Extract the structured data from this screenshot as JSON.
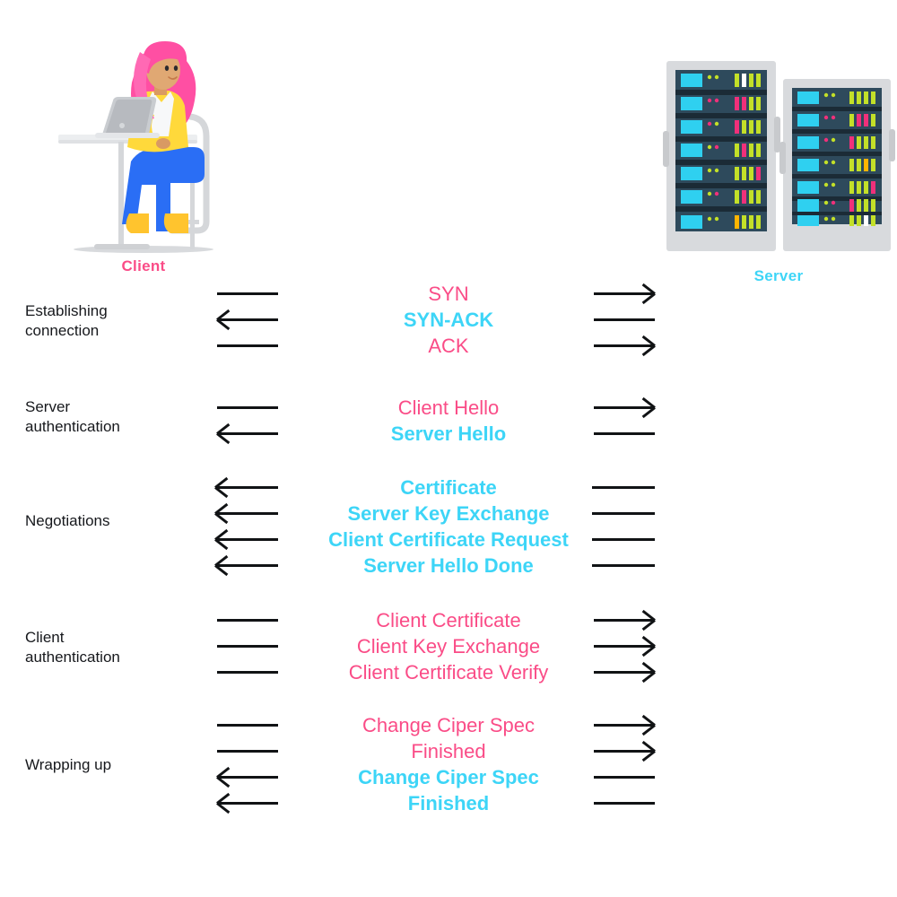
{
  "colors": {
    "client_pink": "#fa4c87",
    "server_cyan": "#3dd5f7",
    "arrow_black": "#111315",
    "label_text": "#16181c"
  },
  "endpoints": {
    "client_label": "Client",
    "server_label": "Server"
  },
  "phases": [
    {
      "label": "Establishing\nconnection",
      "messages": [
        {
          "text": "SYN",
          "direction": "right",
          "color": "pink"
        },
        {
          "text": "SYN-ACK",
          "direction": "left",
          "color": "cyan"
        },
        {
          "text": "ACK",
          "direction": "right",
          "color": "pink"
        }
      ]
    },
    {
      "label": "Server\nauthentication",
      "messages": [
        {
          "text": "Client Hello",
          "direction": "right",
          "color": "pink"
        },
        {
          "text": "Server Hello",
          "direction": "left",
          "color": "cyan"
        }
      ]
    },
    {
      "label": "Negotiations",
      "messages": [
        {
          "text": "Certificate",
          "direction": "left",
          "color": "cyan"
        },
        {
          "text": "Server Key Exchange",
          "direction": "left",
          "color": "cyan"
        },
        {
          "text": "Client Certificate Request",
          "direction": "left",
          "color": "cyan"
        },
        {
          "text": "Server Hello Done",
          "direction": "left",
          "color": "cyan"
        }
      ]
    },
    {
      "label": "Client\nauthentication",
      "messages": [
        {
          "text": "Client Certificate",
          "direction": "right",
          "color": "pink"
        },
        {
          "text": "Client Key Exchange",
          "direction": "right",
          "color": "pink"
        },
        {
          "text": "Client Certificate Verify",
          "direction": "right",
          "color": "pink"
        }
      ]
    },
    {
      "label": "Wrapping up",
      "messages": [
        {
          "text": "Change Ciper Spec",
          "direction": "right",
          "color": "pink"
        },
        {
          "text": "Finished",
          "direction": "right",
          "color": "pink"
        },
        {
          "text": "Change Ciper Spec",
          "direction": "left",
          "color": "cyan"
        },
        {
          "text": "Finished",
          "direction": "left",
          "color": "cyan"
        }
      ]
    }
  ]
}
